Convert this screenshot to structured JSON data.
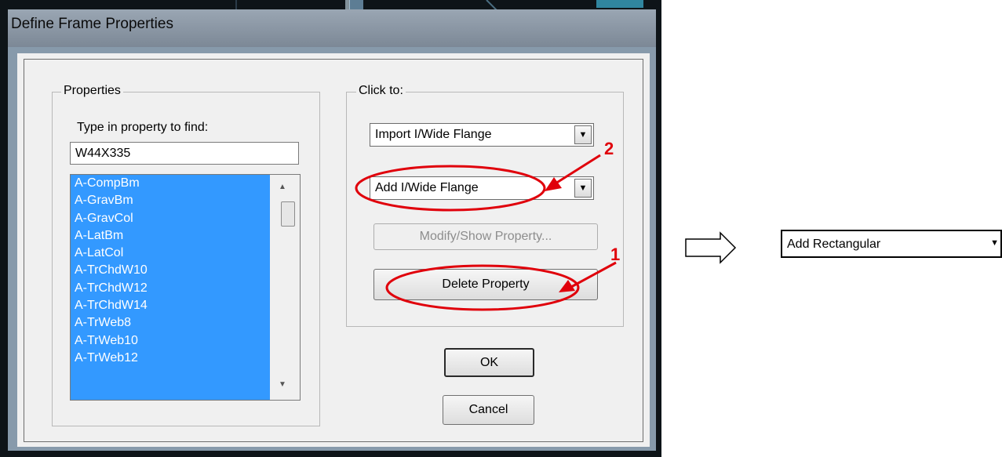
{
  "window": {
    "title": "Define Frame Properties"
  },
  "properties_group": {
    "legend": "Properties",
    "search_hint": "Type in property to find:",
    "search_value": "W44X335",
    "items": [
      "A-CompBm",
      "A-GravBm",
      "A-GravCol",
      "A-LatBm",
      "A-LatCol",
      "A-TrChdW10",
      "A-TrChdW12",
      "A-TrChdW14",
      "A-TrWeb8",
      "A-TrWeb10",
      "A-TrWeb12"
    ]
  },
  "click_group": {
    "legend": "Click to:",
    "import_select": "Import I/Wide Flange",
    "add_select": "Add I/Wide Flange",
    "modify_button": "Modify/Show Property...",
    "delete_button": "Delete Property"
  },
  "ok_button": "OK",
  "cancel_button": "Cancel",
  "annotations": {
    "marker_1": "1",
    "marker_2": "2",
    "accent_color": "#e0000b"
  },
  "external_select": {
    "value": "Add Rectangular"
  },
  "colors": {
    "list_selection": "#3399ff",
    "title_bar": "#8795a3"
  }
}
